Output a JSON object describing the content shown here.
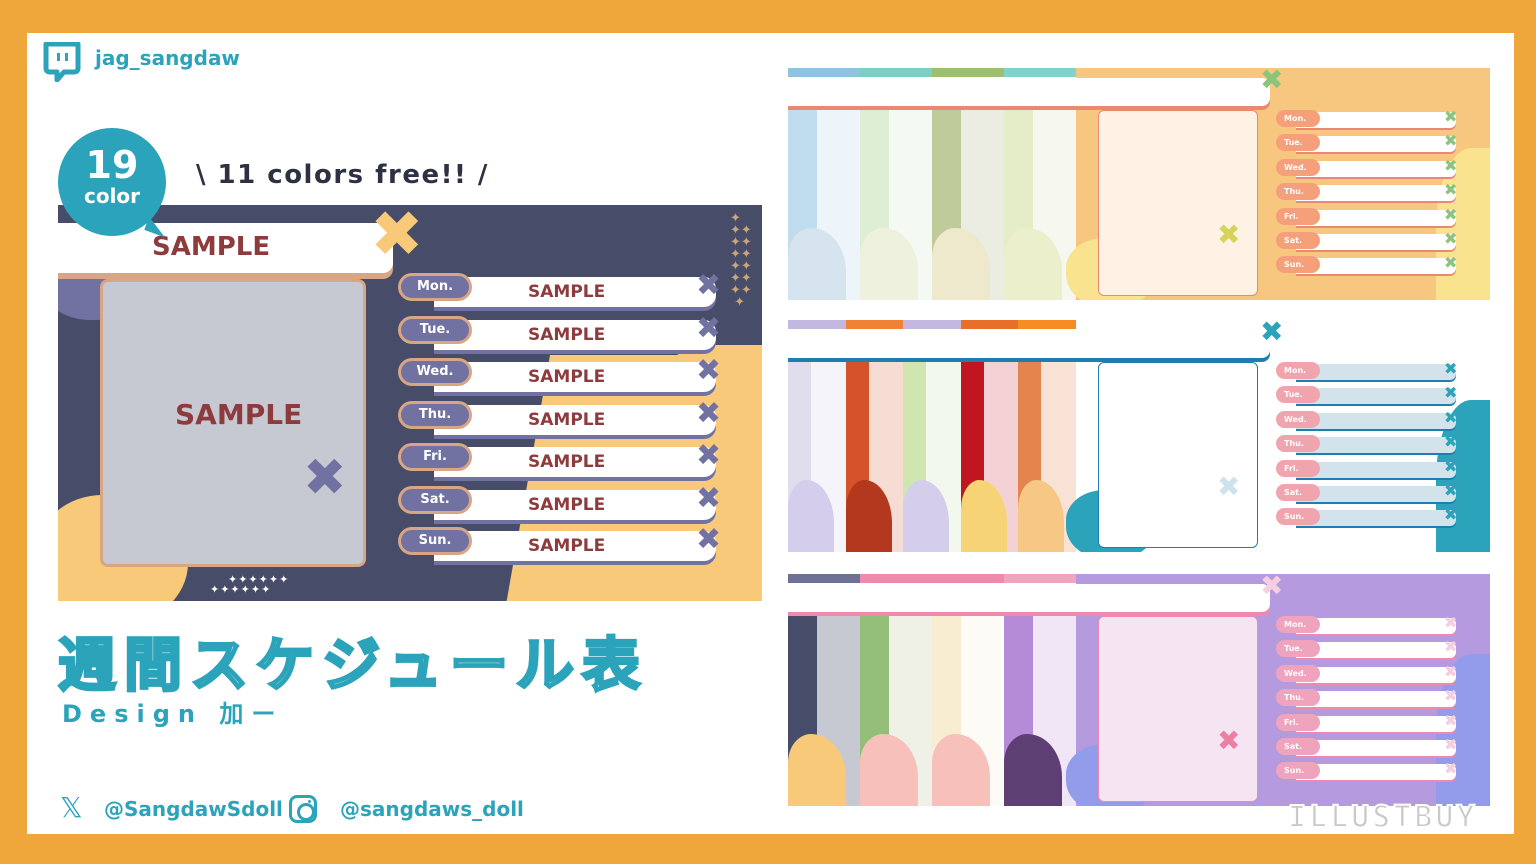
{
  "header": {
    "platform_icon": "twitch-icon",
    "handle": "jag_sangdaw"
  },
  "badge": {
    "number": "19",
    "label": "color"
  },
  "tagline": "\\ 11 colors free!! /",
  "preview": {
    "title": "SAMPLE",
    "frame_text": "SAMPLE",
    "days": [
      {
        "day": "Mon.",
        "text": "SAMPLE"
      },
      {
        "day": "Tue.",
        "text": "SAMPLE"
      },
      {
        "day": "Wed.",
        "text": "SAMPLE"
      },
      {
        "day": "Thu.",
        "text": "SAMPLE"
      },
      {
        "day": "Fri.",
        "text": "SAMPLE"
      },
      {
        "day": "Sat.",
        "text": "SAMPLE"
      },
      {
        "day": "Sun.",
        "text": "SAMPLE"
      }
    ],
    "colors": {
      "background": "#474D69",
      "accent": "#7272A2",
      "blob": "#F9C97A",
      "text": "#8E3B3E",
      "border": "#D8A585"
    }
  },
  "title_jp": "週間スケジュール表",
  "design_credit": "Design 加ー",
  "socials": {
    "x_icon": "x-logo-icon",
    "x_handle": "@SangdawSdoll",
    "instagram_icon": "instagram-icon",
    "instagram_handle": "@sangdaws_doll"
  },
  "variants": [
    {
      "name": "panel-1",
      "strips": [
        {
          "top": "#8FC3E0",
          "side": "#BFDDEE",
          "inner": "#EEF5FA",
          "blob": "#D5E4EE"
        },
        {
          "top": "#7DCFC6",
          "side": "#DDEED5",
          "inner": "#F5F9F3",
          "blob": "#EEF1DE"
        },
        {
          "top": "#9DBF72",
          "side": "#BFCC9A",
          "inner": "#EBEDE2",
          "blob": "#EEE8CC"
        },
        {
          "top": "#7FD3CB",
          "side": "#E4EDC5",
          "inner": "#F6F8F0",
          "blob": "#ECEFCC"
        }
      ],
      "main": {
        "bg": "#F8C77F",
        "frame": "#FDF2E4",
        "pill": "#F5A07A",
        "bar": "#FFFFFF",
        "x": "#8BC47A",
        "title_edge": "#EA8874",
        "blob": "#F9E38E",
        "frame_x": "#D6D25A"
      }
    },
    {
      "name": "panel-2",
      "strips": [
        {
          "top": "#C3B9E0",
          "side": "#E0DDEC",
          "inner": "#F5F4FA",
          "blob": "#D5CDEC"
        },
        {
          "top": "#F08235",
          "side": "#D5522A",
          "inner": "#F6DCD2",
          "blob": "#B4381E"
        },
        {
          "top": "#C3B9E0",
          "side": "#CFE6B0",
          "inner": "#F2F8EE",
          "blob": "#D5CDEC"
        },
        {
          "top": "#E86F2A",
          "side": "#C0161F",
          "inner": "#F3D1D4",
          "blob": "#F6D475"
        },
        {
          "top": "#F78D22",
          "side": "#E48550",
          "inner": "#F8E2D6",
          "blob": "#F6C785"
        }
      ],
      "main": {
        "bg": "#FFFFFF",
        "frame": "#FFFFFF",
        "pill": "#F0A5AE",
        "bar": "#D2E3EC",
        "x": "#2BA3BB",
        "title_edge": "#1E7FAE",
        "blob": "#2BA3BB",
        "frame_x": "#CFE3EC"
      }
    },
    {
      "name": "panel-3",
      "strips": [
        {
          "top": "#6E7196",
          "side": "#474D69",
          "inner": "#C6C8D2",
          "blob": "#F9C97A"
        },
        {
          "top": "#F189AE",
          "side": "#93BF78",
          "inner": "#EFF1E7",
          "blob": "#F7C0BA"
        },
        {
          "top": "#F189AE",
          "side": "#F8EDD0",
          "inner": "#FDFBF6",
          "blob": "#F7C0BA"
        },
        {
          "top": "#F0A4BD",
          "side": "#B58AD6",
          "inner": "#F1E6F5",
          "blob": "#5E3F74"
        }
      ],
      "main": {
        "bg": "#B59ADF",
        "frame": "#F5E5F3",
        "pill": "#EFA3BC",
        "bar": "#FFFFFF",
        "x": "#F5CFE0",
        "title_edge": "#F189AE",
        "blob": "#939CEB",
        "frame_x": "#EE7FA3"
      }
    }
  ],
  "variant_days": [
    "Mon.",
    "Tue.",
    "Wed.",
    "Thu.",
    "Fri.",
    "Sat.",
    "Sun."
  ],
  "watermark": "ILLUSTBUY"
}
